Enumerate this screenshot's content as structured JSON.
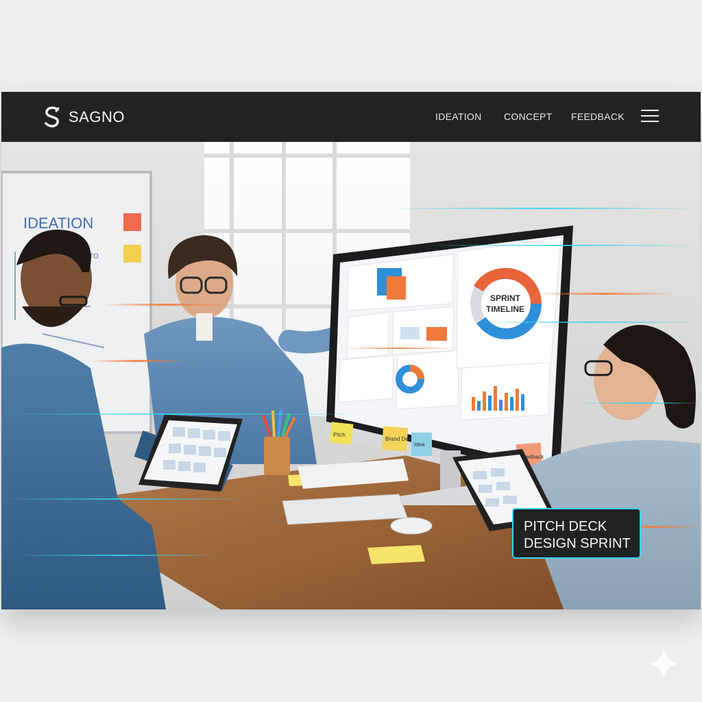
{
  "brand": {
    "name": "SAGNO",
    "logo_letter": "S"
  },
  "nav": {
    "links": [
      "IDEATION",
      "CONCEPT",
      "FEEDBACK"
    ],
    "menu_icon": "hamburger-menu-icon"
  },
  "whiteboard": {
    "heading": "IDEATION",
    "lines": [
      "Pro"
    ]
  },
  "monitor": {
    "center_chart_title_line1": "SPRINT",
    "center_chart_title_line2": "TIMELINE",
    "donut_colors": [
      "#e8643a",
      "#2f8fd8",
      "#d9dde3"
    ]
  },
  "sticky_notes": {
    "under_monitor": [
      "Pitch",
      "Brand Design",
      "Idea"
    ],
    "right": "Feedback"
  },
  "caption": {
    "line1": "PITCH DECK",
    "line2": "DESIGN SPRINT"
  },
  "colors": {
    "nav_bg": "#222223",
    "accent_cyan": "#37d4ef",
    "accent_orange": "#f07a3a",
    "accent_blue": "#2f8fd8"
  }
}
